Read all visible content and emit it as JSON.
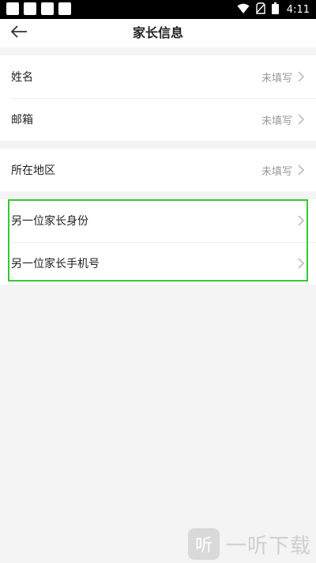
{
  "status_bar": {
    "time": "4:11",
    "icons": [
      "notification-square-icon",
      "notification-square-icon",
      "notification-square-icon",
      "notification-square-icon",
      "wifi-icon",
      "no-sim-icon",
      "battery-icon"
    ]
  },
  "nav": {
    "back_icon": "arrow-left-icon",
    "title": "家长信息"
  },
  "groups": [
    {
      "rows": [
        {
          "label": "姓名",
          "value": "未填写"
        },
        {
          "label": "邮箱",
          "value": "未填写"
        }
      ]
    },
    {
      "rows": [
        {
          "label": "所在地区",
          "value": "未填写"
        }
      ]
    },
    {
      "rows": [
        {
          "label": "另一位家长身份",
          "value": ""
        },
        {
          "label": "另一位家长手机号",
          "value": ""
        }
      ]
    }
  ],
  "colors": {
    "highlight": "#34c934",
    "background": "#f4f4f4",
    "placeholder_text": "#999999"
  },
  "watermark": {
    "logo_text": "听",
    "text": "一听下载"
  }
}
